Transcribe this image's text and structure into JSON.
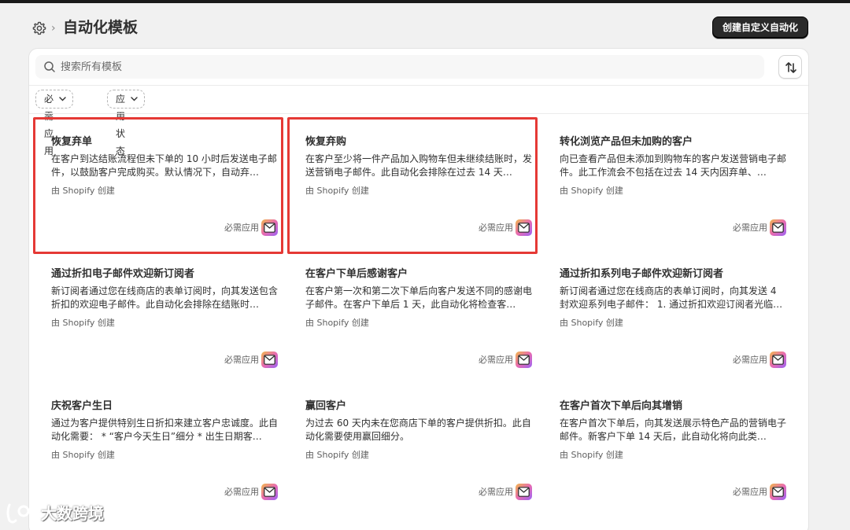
{
  "header": {
    "title": "自动化模板",
    "create_button": "创建自定义自动化"
  },
  "search": {
    "placeholder": "搜索所有模板"
  },
  "filters": [
    {
      "label": "必需应用"
    },
    {
      "label": "应用状态"
    }
  ],
  "templates": [
    {
      "title": "恢复弃单",
      "description": "在客户到达结账流程但未下单的 10 小时后发送电子邮件，以鼓励客户完成购买。默认情况下，自动弃…",
      "creator": "由 Shopify 创建",
      "status": "必需应用",
      "icon": "mail-icon",
      "highlighted": true
    },
    {
      "title": "恢复弃购",
      "description": "在客户至少将一件产品加入购物车但未继续结账时，发送营销电子邮件。此自动化会排除在过去 14 天…",
      "creator": "由 Shopify 创建",
      "status": "必需应用",
      "icon": "mail-icon",
      "highlighted": true
    },
    {
      "title": "转化浏览产品但未加购的客户",
      "description": "向已查看产品但未添加到购物车的客户发送营销电子邮件。此工作流会不包括在过去 14 天内因弃单、…",
      "creator": "由 Shopify 创建",
      "status": "必需应用",
      "icon": "mail-icon",
      "highlighted": false
    },
    {
      "title": "通过折扣电子邮件欢迎新订阅者",
      "description": "新订阅者通过您在线商店的表单订阅时，向其发送包含折扣的欢迎电子邮件。此自动化会排除在结账时…",
      "creator": "由 Shopify 创建",
      "status": "必需应用",
      "icon": "mail-icon",
      "highlighted": false
    },
    {
      "title": "在客户下单后感谢客户",
      "description": "在客户第一次和第二次下单后向客户发送不同的感谢电子邮件。在客户下单后 1 天，此自动化将检查客…",
      "creator": "由 Shopify 创建",
      "status": "必需应用",
      "icon": "mail-icon",
      "highlighted": false
    },
    {
      "title": "通过折扣系列电子邮件欢迎新订阅者",
      "description": "新订阅者通过您在线商店的表单订阅时，向其发送 4 封欢迎系列电子邮件： 1. 通过折扣欢迎订阅者光临…",
      "creator": "由 Shopify 创建",
      "status": "必需应用",
      "icon": "mail-icon",
      "highlighted": false
    },
    {
      "title": "庆祝客户生日",
      "description": "通过为客户提供特别生日折扣来建立客户忠诚度。此自动化需要： * “客户今天生日”细分 * 出生日期客…",
      "creator": "由 Shopify 创建",
      "status": "必需应用",
      "icon": "mail-icon",
      "highlighted": false
    },
    {
      "title": "赢回客户",
      "description": "为过去 60 天内未在您商店下单的客户提供折扣。此自动化需要使用赢回细分。",
      "creator": "由 Shopify 创建",
      "status": "必需应用",
      "icon": "mail-icon",
      "highlighted": false
    },
    {
      "title": "在客户首次下单后向其增销",
      "description": "在客户首次下单后，向其发送展示特色产品的营销电子邮件。新客户下单 14 天后，此自动化将向此类…",
      "creator": "由 Shopify 创建",
      "status": "必需应用",
      "icon": "mail-icon",
      "highlighted": false
    }
  ],
  "watermark": {
    "text": "大数跨境"
  }
}
